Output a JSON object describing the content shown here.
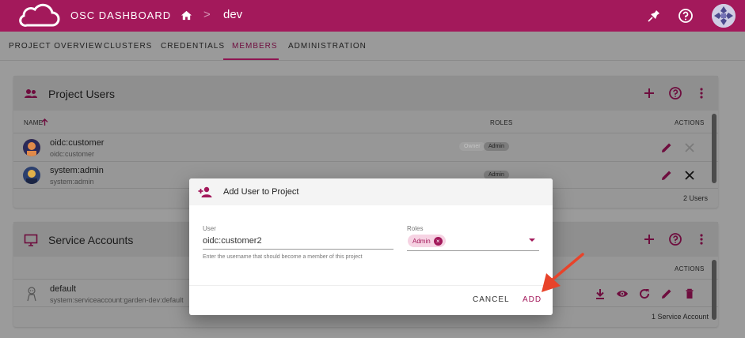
{
  "header": {
    "app_title": "OSC DASHBOARD",
    "breadcrumb_sep": ">",
    "breadcrumb_project": "dev",
    "icons": [
      "cloud-logo-icon",
      "home-icon",
      "pin-icon",
      "help-icon",
      "avatar"
    ]
  },
  "tabs": [
    {
      "label": "PROJECT OVERVIEW"
    },
    {
      "label": "CLUSTERS"
    },
    {
      "label": "CREDENTIALS"
    },
    {
      "label": "MEMBERS"
    },
    {
      "label": "ADMINISTRATION"
    }
  ],
  "active_tab": "MEMBERS",
  "project_users": {
    "title": "Project Users",
    "columns": {
      "name": "NAME",
      "roles": "ROLES",
      "actions": "ACTIONS"
    },
    "rows": [
      {
        "name": "oidc:customer",
        "sub": "oidc:customer",
        "roles": [
          "Owner",
          "Admin"
        ]
      },
      {
        "name": "system:admin",
        "sub": "system:admin",
        "roles": [
          "Admin"
        ]
      }
    ],
    "footer": "2 Users"
  },
  "service_accounts": {
    "title": "Service Accounts",
    "columns": {
      "actions": "ACTIONS"
    },
    "rows": [
      {
        "name": "default",
        "sub": "system:serviceaccount:garden-dev:default"
      }
    ],
    "footer": "1 Service Account"
  },
  "dialog": {
    "title": "Add User to Project",
    "user_label": "User",
    "user_value": "oidc:customer2",
    "user_hint": "Enter the username that should become a member of this project",
    "roles_label": "Roles",
    "role_chip": "Admin",
    "chip_remove_glyph": "×",
    "cancel_label": "CANCEL",
    "add_label": "ADD"
  },
  "colors": {
    "brand": "#a3195b",
    "overlay": "#9b9b9b",
    "annotation_arrow": "#e8432a"
  }
}
